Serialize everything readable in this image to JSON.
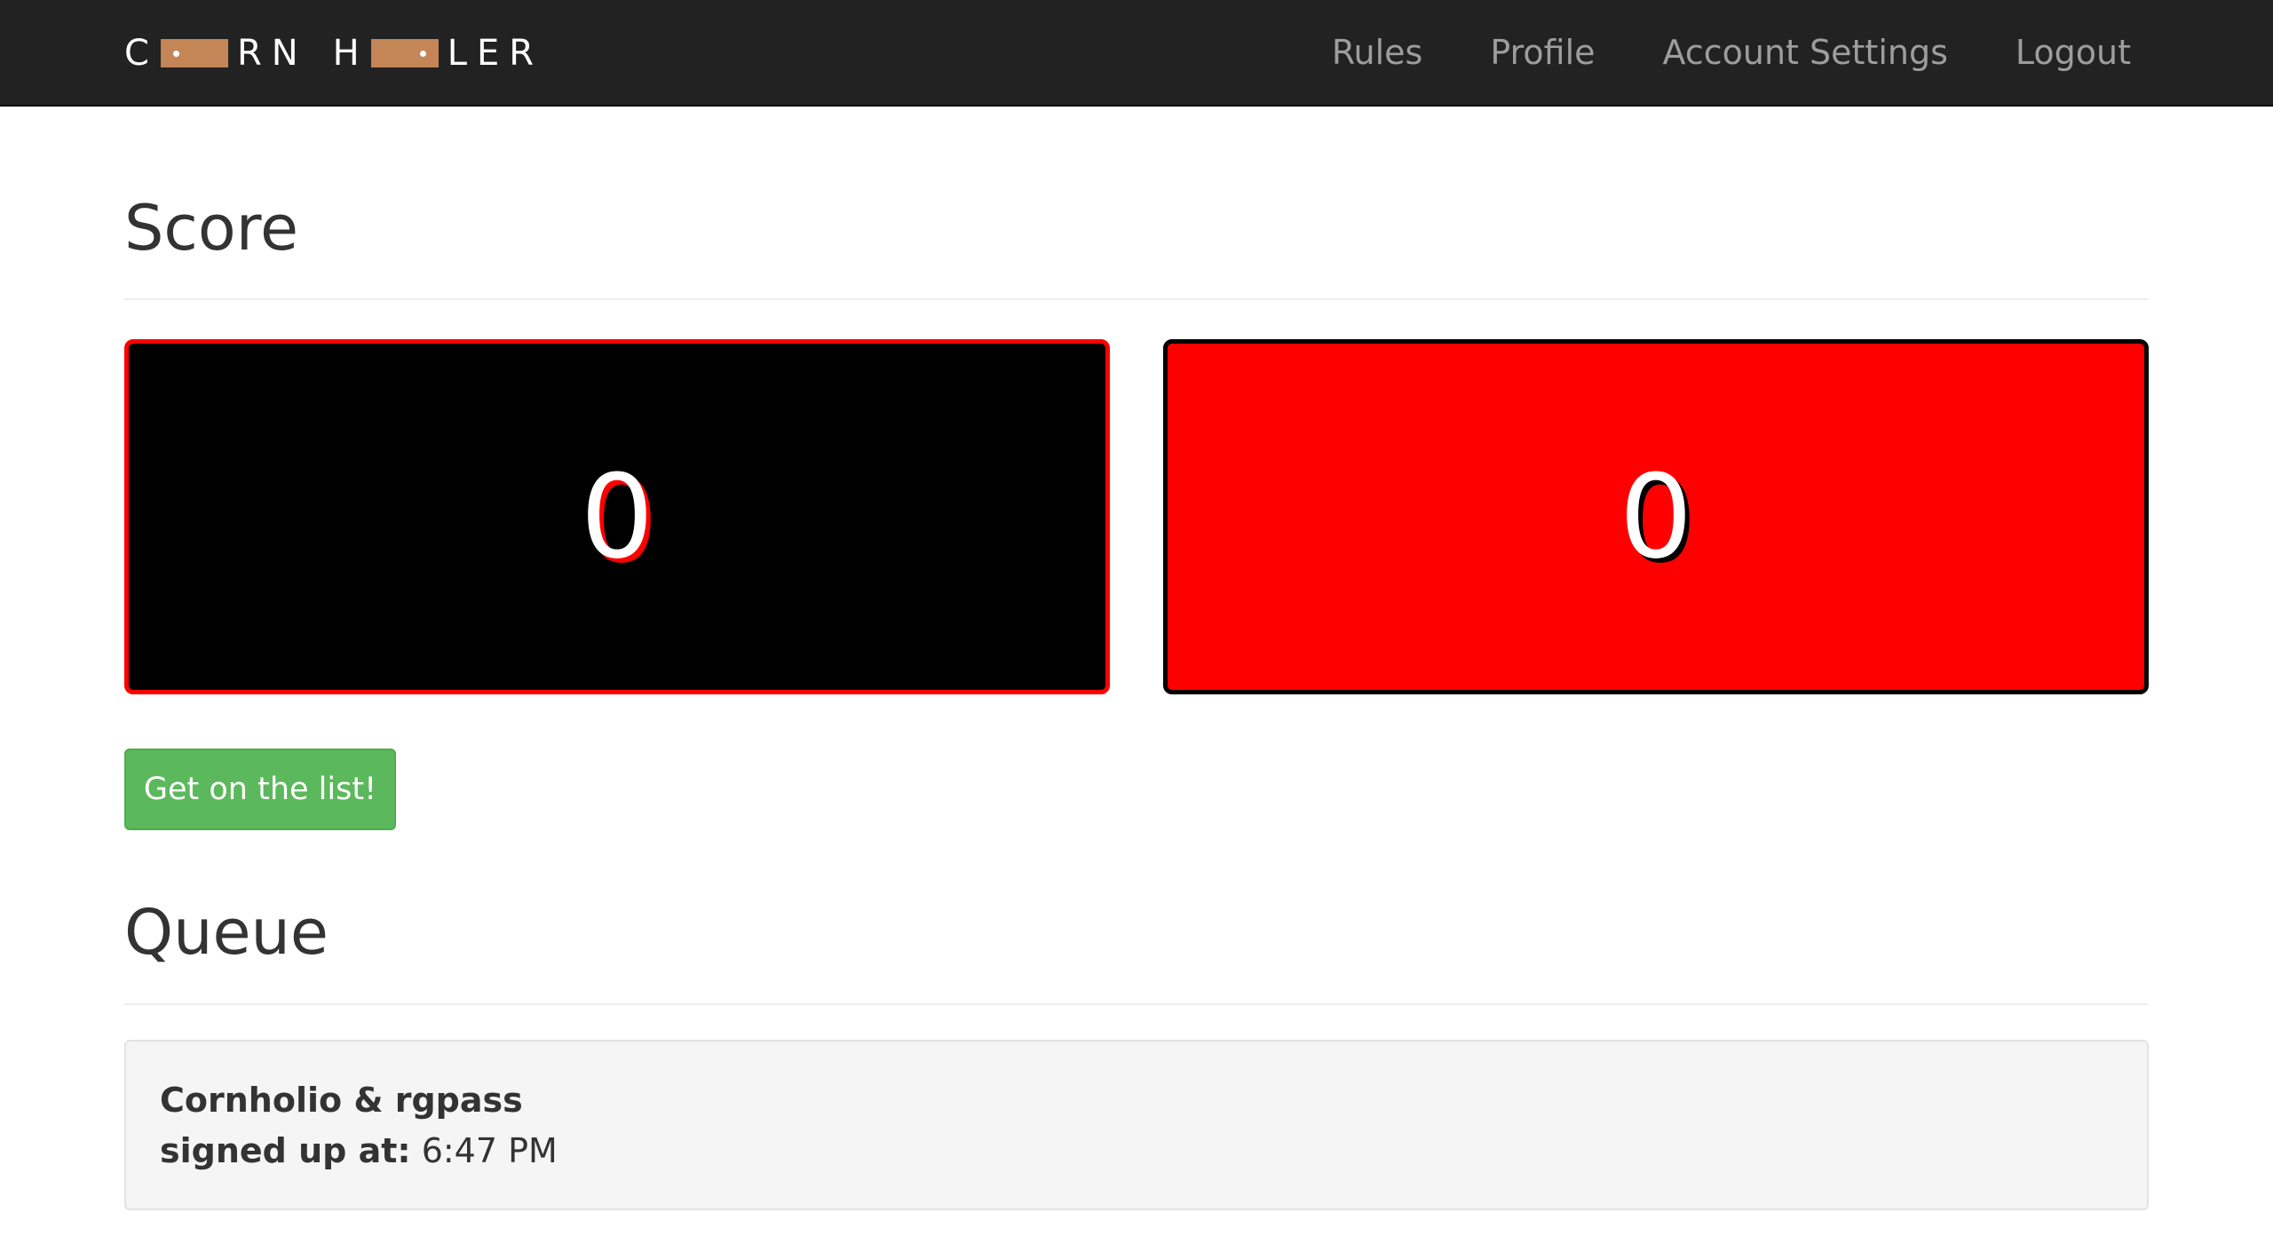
{
  "navbar": {
    "brand": {
      "part1_left": "C",
      "part1_right": "RN",
      "part2_left": "H",
      "part2_right": "LER",
      "board_color": "#c48557"
    },
    "links": [
      {
        "label": "Rules"
      },
      {
        "label": "Profile"
      },
      {
        "label": "Account Settings"
      },
      {
        "label": "Logout"
      }
    ]
  },
  "score": {
    "heading": "Score",
    "teams": [
      {
        "value": "0",
        "background": "#000000",
        "border": "#ff0000"
      },
      {
        "value": "0",
        "background": "#ff0000",
        "border": "#000000"
      }
    ]
  },
  "join_button": {
    "label": "Get on the list!",
    "color": "#5cb85c"
  },
  "queue": {
    "heading": "Queue",
    "entries": [
      {
        "players": "Cornholio & rgpass",
        "signup_label": "signed up at:",
        "signup_time": "6:47 PM"
      }
    ]
  }
}
